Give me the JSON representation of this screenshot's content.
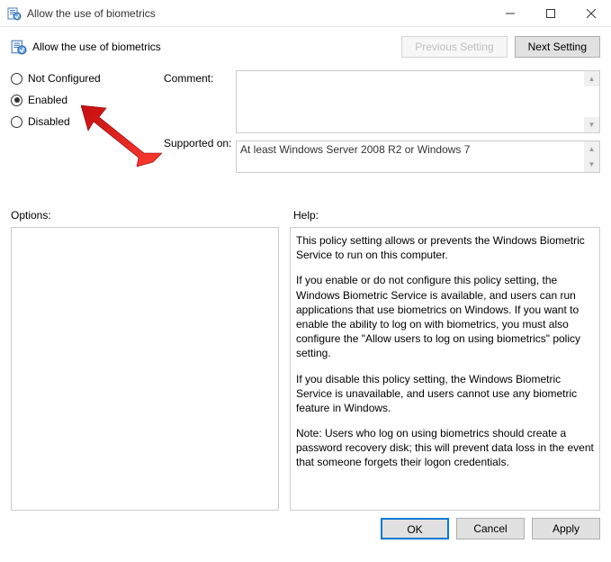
{
  "titlebar": {
    "title": "Allow the use of biometrics"
  },
  "header": {
    "title": "Allow the use of biometrics",
    "prev_btn": "Previous Setting",
    "next_btn": "Next Setting"
  },
  "radios": {
    "not_configured": "Not Configured",
    "enabled": "Enabled",
    "disabled": "Disabled",
    "selected": "enabled"
  },
  "labels": {
    "comment": "Comment:",
    "supported": "Supported on:",
    "options": "Options:",
    "help": "Help:"
  },
  "fields": {
    "comment": "",
    "supported": "At least Windows Server 2008 R2 or Windows 7"
  },
  "options_panel": "",
  "help_text": {
    "p1": "This policy setting allows or prevents the Windows Biometric Service to run on this computer.",
    "p2": "If you enable or do not configure this policy setting, the Windows Biometric Service is available, and users can run applications that use biometrics on Windows. If you want to enable the ability to log on with biometrics, you must also configure the \"Allow users to log on using biometrics\" policy setting.",
    "p3": "If you disable this policy setting, the Windows Biometric Service is unavailable, and users cannot use any biometric feature in Windows.",
    "p4": "Note: Users who log on using biometrics should create a password recovery disk; this will prevent data loss in the event that someone forgets their logon credentials."
  },
  "footer": {
    "ok": "OK",
    "cancel": "Cancel",
    "apply": "Apply"
  }
}
